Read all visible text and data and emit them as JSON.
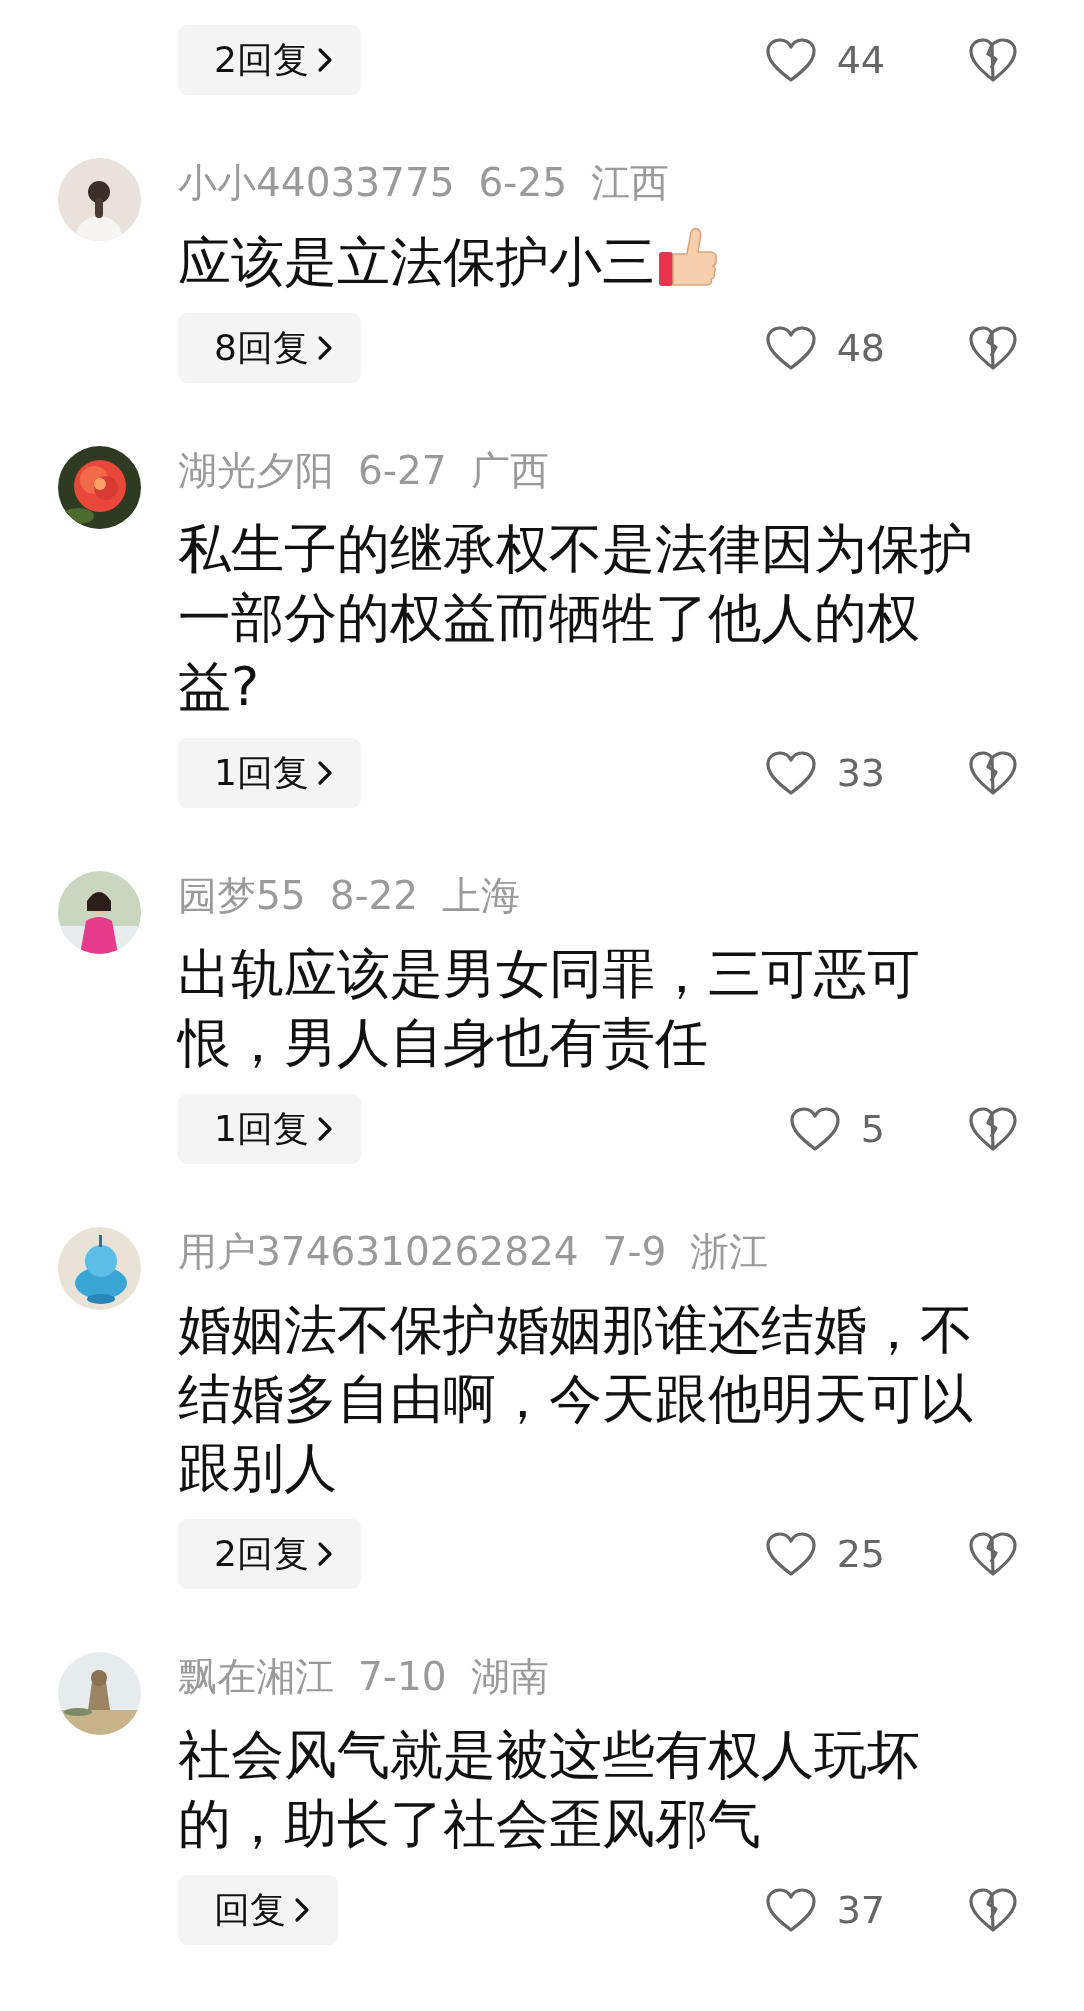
{
  "top_reply": {
    "replies": "2回复",
    "likes": "44"
  },
  "comments": [
    {
      "user": "小小44033775",
      "date": "6-25",
      "region": "江西",
      "text": "应该是立法保护小三",
      "has_emoji": true,
      "replies": "8回复",
      "likes": "48"
    },
    {
      "user": "湖光夕阳",
      "date": "6-27",
      "region": "广西",
      "text": "私生子的继承权不是法律因为保护一部分的权益而牺牲了他人的权益?",
      "has_emoji": false,
      "replies": "1回复",
      "likes": "33"
    },
    {
      "user": "园梦55",
      "date": "8-22",
      "region": "上海",
      "text": "出轨应该是男女同罪，三可恶可恨，男人自身也有责任",
      "has_emoji": false,
      "replies": "1回复",
      "likes": "5"
    },
    {
      "user": "用户3746310262824",
      "date": "7-9",
      "region": "浙江",
      "text": "婚姻法不保护婚姻那谁还结婚，不结婚多自由啊，今天跟他明天可以跟别人",
      "has_emoji": false,
      "replies": "2回复",
      "likes": "25"
    },
    {
      "user": "飘在湘江",
      "date": "7-10",
      "region": "湖南",
      "text": "社会风气就是被这些有权人玩坏的，助长了社会歪风邪气",
      "has_emoji": false,
      "replies": "回复",
      "likes": "37"
    }
  ]
}
